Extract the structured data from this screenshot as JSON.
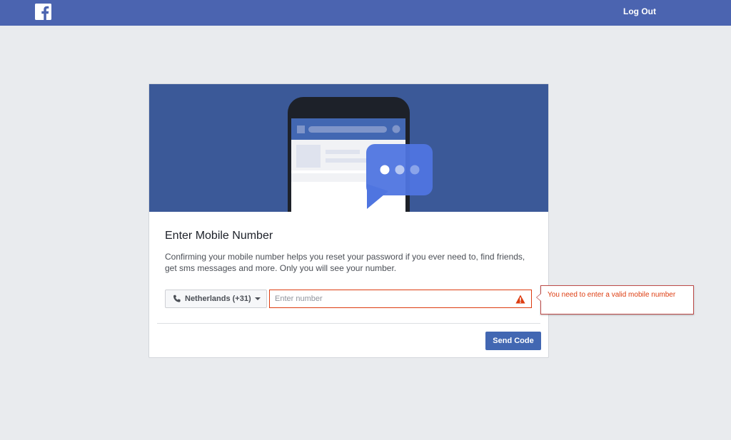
{
  "topbar": {
    "logo_icon": "facebook-logo-icon",
    "logout_label": "Log Out",
    "background": "#4b64b0"
  },
  "card": {
    "hero_icon": "phone-chat-illustration",
    "title": "Enter Mobile Number",
    "description": "Confirming your mobile number helps you reset your password if you ever need to, find friends, get sms messages and more. Only you will see your number.",
    "country_selector": {
      "icon": "phone-icon",
      "selected": "Netherlands (+31)"
    },
    "number_input": {
      "value": "",
      "placeholder": "Enter number",
      "error_icon": "warning-icon"
    },
    "send_button_label": "Send Code"
  },
  "tooltip": {
    "message": "You need to enter a valid mobile number"
  },
  "colors": {
    "accent": "#4267b2",
    "hero": "#3b5998",
    "error": "#dd3c10",
    "page_background": "#e9ebee"
  }
}
